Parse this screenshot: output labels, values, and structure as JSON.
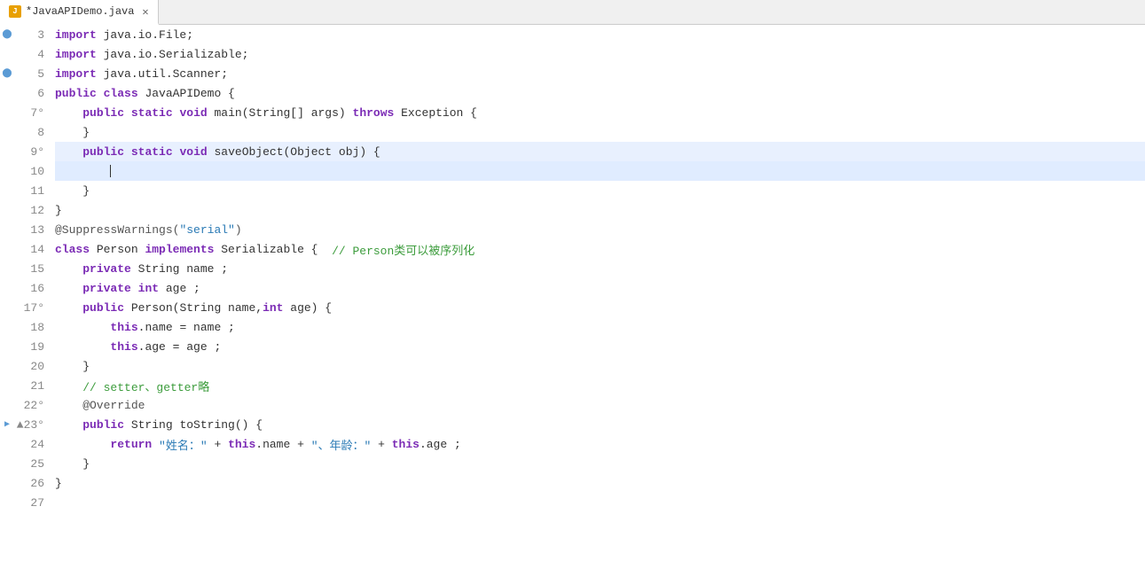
{
  "tab": {
    "title": "*JavaAPIDemo.java",
    "close_label": "✕",
    "icon_label": "J"
  },
  "colors": {
    "keyword": "#7b2bb5",
    "keyword_bold": "#7b2bb5",
    "string": "#2a7ab5",
    "comment": "#3c9c3c",
    "plain": "#333333",
    "line_highlight": "#e8f0fe",
    "active_line_bg": "#e0ecff"
  },
  "lines": [
    {
      "num": 3,
      "indent": 0,
      "marker": "bp",
      "content": "import java.io.File;"
    },
    {
      "num": 4,
      "indent": 0,
      "marker": "",
      "content": "import java.io.Serializable;"
    },
    {
      "num": 5,
      "indent": 0,
      "marker": "bp",
      "content": "import java.util.Scanner;"
    },
    {
      "num": 6,
      "indent": 0,
      "marker": "",
      "content": "public class JavaAPIDemo {"
    },
    {
      "num": 7,
      "indent": 1,
      "marker": "fold",
      "content": "    public static void main(String[] args) throws Exception {"
    },
    {
      "num": 8,
      "indent": 2,
      "marker": "",
      "content": "    }"
    },
    {
      "num": 9,
      "indent": 1,
      "marker": "fold",
      "content": "    public static void saveObject(Object obj) {"
    },
    {
      "num": 10,
      "indent": 0,
      "marker": "",
      "content": ""
    },
    {
      "num": 11,
      "indent": 2,
      "marker": "",
      "content": "    }"
    },
    {
      "num": 12,
      "indent": 0,
      "marker": "",
      "content": "}"
    },
    {
      "num": 13,
      "indent": 0,
      "marker": "",
      "content": "@SuppressWarnings(\"serial\")"
    },
    {
      "num": 14,
      "indent": 0,
      "marker": "",
      "content": "class Person implements Serializable {  // Person类可以被序列化"
    },
    {
      "num": 15,
      "indent": 1,
      "marker": "",
      "content": "    private String name ;"
    },
    {
      "num": 16,
      "indent": 1,
      "marker": "",
      "content": "    private int age ;"
    },
    {
      "num": 17,
      "indent": 1,
      "marker": "fold",
      "content": "    public Person(String name,int age) {"
    },
    {
      "num": 18,
      "indent": 2,
      "marker": "",
      "content": "        this.name = name ;"
    },
    {
      "num": 19,
      "indent": 2,
      "marker": "",
      "content": "        this.age = age ;"
    },
    {
      "num": 20,
      "indent": 2,
      "marker": "",
      "content": "    }"
    },
    {
      "num": 21,
      "indent": 1,
      "marker": "",
      "content": "    // setter、getter略"
    },
    {
      "num": 22,
      "indent": 1,
      "marker": "fold",
      "content": "    @Override"
    },
    {
      "num": 23,
      "indent": 1,
      "marker": "arrow",
      "content": "    public String toString() {"
    },
    {
      "num": 24,
      "indent": 2,
      "marker": "",
      "content": "        return \"姓名：\" + this.name + \"、年龄：\" + this.age ;"
    },
    {
      "num": 25,
      "indent": 2,
      "marker": "",
      "content": "    }"
    },
    {
      "num": 26,
      "indent": 0,
      "marker": "",
      "content": "}"
    },
    {
      "num": 27,
      "indent": 0,
      "marker": "",
      "content": ""
    }
  ]
}
